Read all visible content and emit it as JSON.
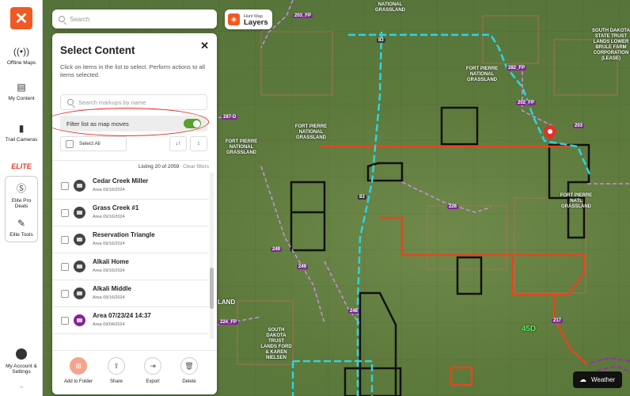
{
  "nav": {
    "logo_icon": "close-x-logo",
    "offline_maps": "Offline Maps",
    "my_content": "My Content",
    "trail_cameras": "Trail Cameras",
    "elite_heading": "ELITE",
    "elite_pro_deals": "Elite Pro Deals",
    "elite_tools": "Elite Tools",
    "account": "My Account & Settings"
  },
  "search": {
    "placeholder": "Search"
  },
  "layers": {
    "subtitle": "Hunt Map",
    "title": "Layers"
  },
  "panel": {
    "title": "Select Content",
    "description": "Click on items in the list to select. Perform actions to all items selected.",
    "markup_search_placeholder": "Search markups by name",
    "filter_label": "Filter list as map moves",
    "filter_on": true,
    "select_all": "Select All",
    "listing_text": "Listing 20 of 2059",
    "clear_filters": "Clear filters",
    "items": [
      {
        "name": "Cedar Creek Miller",
        "detail": "Area 09/16/2024",
        "icon": "area-icon"
      },
      {
        "name": "Grass Creek #1",
        "detail": "Area 09/16/2024",
        "icon": "area-icon"
      },
      {
        "name": "Reservation Triangle",
        "detail": "Area 09/16/2024",
        "icon": "area-icon"
      },
      {
        "name": "Alkali Home",
        "detail": "Area 09/16/2024",
        "icon": "area-icon"
      },
      {
        "name": "Alkali Middle",
        "detail": "Area 09/16/2024",
        "icon": "area-icon"
      },
      {
        "name": "Area 07/23/24 14:37",
        "detail": "Area 09/04/2024",
        "icon": "area-icon-purple"
      }
    ],
    "actions": {
      "add_to_folder": "Add to Folder",
      "share": "Share",
      "export": "Export",
      "delete": "Delete"
    }
  },
  "map": {
    "labels": {
      "national_grassland_1": "NATIONAL GRASSLAND",
      "fort_pierre_1": "FORT PIERRE NATIONAL GRASSLAND",
      "fort_pierre_2": "FORT PIERRE NATIONAL GRASSLAND",
      "fort_pierre_3": "FORT PIERRE NATIONAL GRASSLAND",
      "fort_pierre_natl": "FORT PIERRE NATL GRASSLAND",
      "sd_state": "SOUTH DAKOTA STATE TRUST LANDS LOWER BRULE FARM CORPORATION (LEASE)",
      "land": "LAND",
      "sd_trust_2": "SOUTH DAKOTA TRUST LANDS FORD & KAREN NIELSEN",
      "unit": "45D"
    },
    "roads": [
      "203_FP",
      "282_FP",
      "202_FP",
      "203",
      "226",
      "249",
      "249",
      "248",
      "224_FP",
      "217",
      "287-D",
      "83",
      "83"
    ]
  },
  "weather": {
    "label": "Weather"
  },
  "colors": {
    "accent": "#f05a22",
    "toggle_on": "#5aa02c",
    "highlight_oval": "#e0322b",
    "road_cyan": "#2fd3e0",
    "boundary_orange": "#e2471f"
  }
}
